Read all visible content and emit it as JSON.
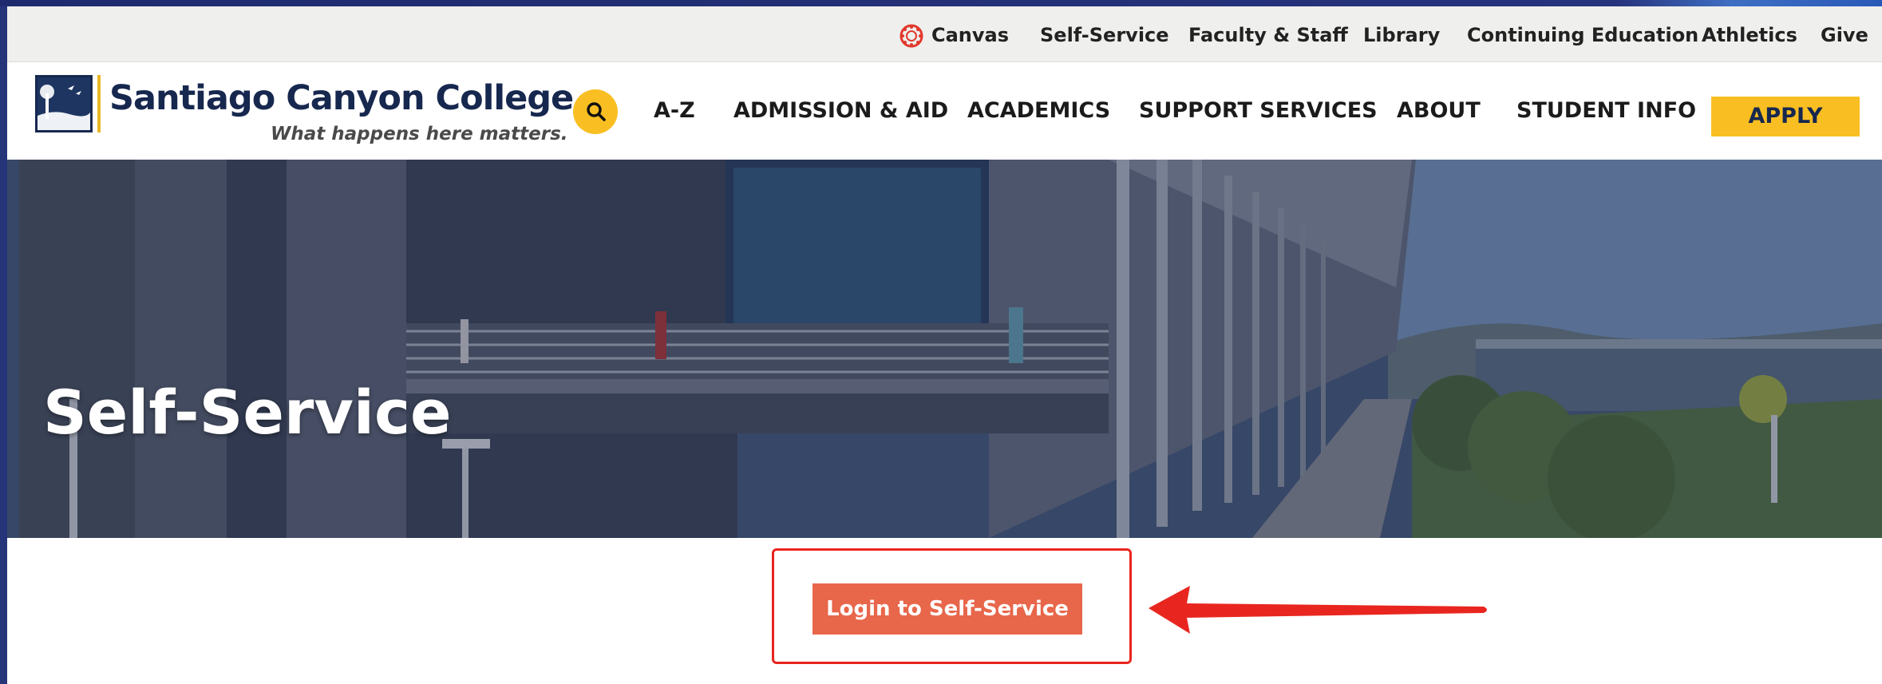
{
  "utility_nav": {
    "items": [
      {
        "label": "Canvas"
      },
      {
        "label": "Self-Service"
      },
      {
        "label": "Faculty & Staff"
      },
      {
        "label": "Library"
      },
      {
        "label": "Continuing Education"
      },
      {
        "label": "Athletics"
      },
      {
        "label": "Give"
      }
    ]
  },
  "brand": {
    "name": "Santiago Canyon College",
    "tagline": "What happens here matters."
  },
  "main_nav": {
    "items": [
      {
        "label": "A-Z"
      },
      {
        "label": "ADMISSION & AID"
      },
      {
        "label": "ACADEMICS"
      },
      {
        "label": "SUPPORT SERVICES"
      },
      {
        "label": "ABOUT"
      },
      {
        "label": "STUDENT INFO"
      }
    ],
    "apply_label": "APPLY"
  },
  "hero": {
    "title": "Self-Service"
  },
  "content": {
    "login_label": "Login to Self-Service"
  },
  "colors": {
    "brand_navy": "#17284f",
    "accent_gold": "#f9bf22",
    "login_orange": "#e8664a",
    "annotation_red": "#e8261f"
  }
}
